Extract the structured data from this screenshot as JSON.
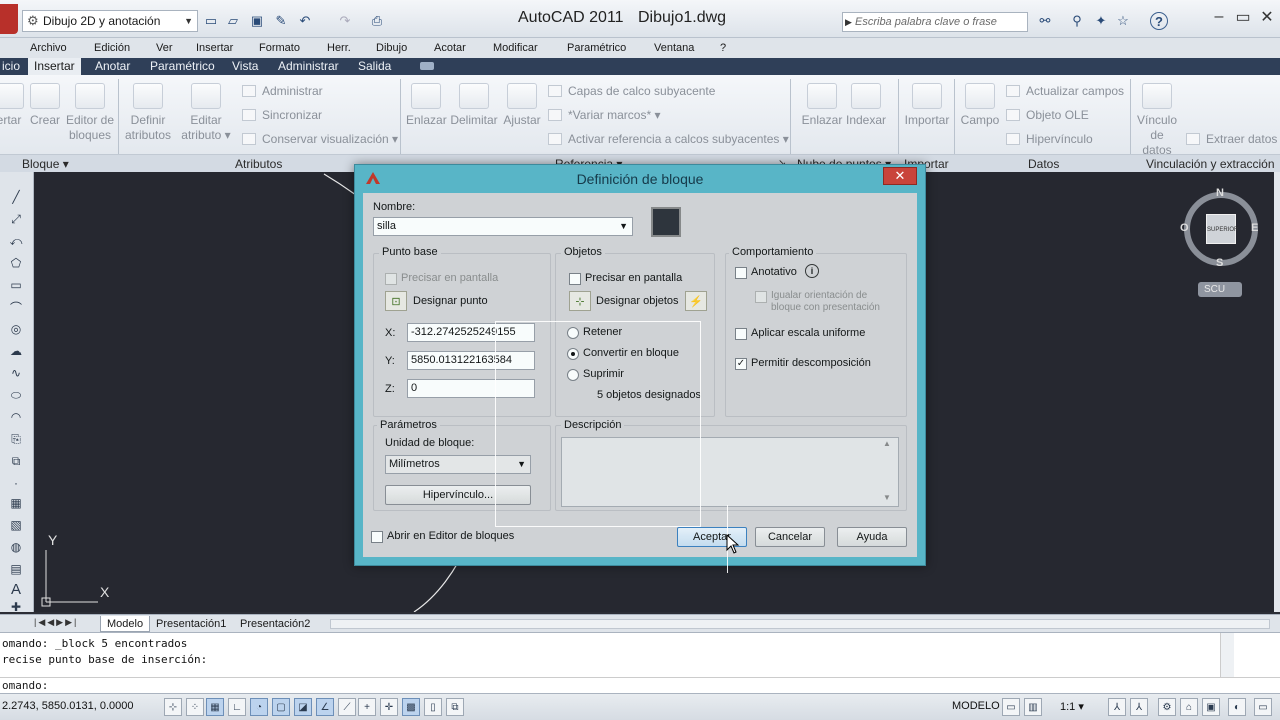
{
  "titlebar": {
    "workspace": "Dibujo 2D y anotación",
    "app_title": "AutoCAD 2011",
    "file_title": "Dibujo1.dwg",
    "search_placeholder": "Escriba palabra clave o frase",
    "help_icon": "?"
  },
  "menubar": [
    "Archivo",
    "Edición",
    "Ver",
    "Insertar",
    "Formato",
    "Herr.",
    "Dibujo",
    "Acotar",
    "Modificar",
    "Paramétrico",
    "Ventana",
    "?"
  ],
  "ribbon_tabs": [
    "icio",
    "Insertar",
    "Anotar",
    "Paramétrico",
    "Vista",
    "Administrar",
    "Salida"
  ],
  "ribbon_active_tab": "Insertar",
  "ribbon": {
    "block": {
      "label": "Bloque ▾",
      "buttons": [
        "ertar",
        "Crear",
        "Editor de\nbloques"
      ]
    },
    "attributes": {
      "label": "Atributos",
      "buttons": [
        "Definir\natributos",
        "Editar\natributo ▾"
      ],
      "small": [
        "Administrar",
        "Sincronizar",
        "Conservar visualización ▾"
      ]
    },
    "reference": {
      "label": "Referencia ▾",
      "buttons": [
        "Enlazar",
        "Delimitar",
        "Ajustar"
      ],
      "small": [
        "Capas de calco subyacente",
        "*Variar marcos* ▾",
        "Activar referencia a calcos subyacentes ▾"
      ]
    },
    "pointcloud": {
      "label": "Nube de puntos ▾",
      "buttons": [
        "Enlazar",
        "Indexar"
      ]
    },
    "import": {
      "label": "Importar",
      "buttons": [
        "Importar"
      ]
    },
    "data": {
      "label": "Datos",
      "buttons": [
        "Campo"
      ],
      "small": [
        "Actualizar campos",
        "Objeto OLE",
        "Hipervínculo"
      ]
    },
    "linking": {
      "label": "Vinculación y extracción",
      "buttons": [
        "Vínculo\nde datos"
      ],
      "small": [
        "Extraer  datos"
      ]
    }
  },
  "viewcube": {
    "north": "N",
    "south": "S",
    "east": "E",
    "west": "O",
    "face": "SUPERIOR",
    "ucs": "SCU"
  },
  "ucs_axes": {
    "x": "X",
    "y": "Y"
  },
  "layout_tabs": [
    "Modelo",
    "Presentación1",
    "Presentación2"
  ],
  "command_history": [
    "omando: _block 5 encontrados",
    "recise punto base de inserción:"
  ],
  "command_prompt": "omando:",
  "statusbar": {
    "coords": "2.2743, 5850.0131, 0.0000",
    "model": "MODELO",
    "scale": "1:1 ▾"
  },
  "dialog": {
    "title": "Definición de bloque",
    "close": "✕",
    "name_label": "Nombre:",
    "name_value": "silla",
    "base_point": {
      "title": "Punto base",
      "specify_on_screen": "Precisar en pantalla",
      "pick_button": "Designar punto",
      "x_label": "X:",
      "x_value": "-312.2742525249155",
      "y_label": "Y:",
      "y_value": "5850.013122163584",
      "z_label": "Z:",
      "z_value": "0"
    },
    "objects": {
      "title": "Objetos",
      "specify_on_screen": "Precisar en pantalla",
      "select_button": "Designar objetos",
      "retain": "Retener",
      "convert": "Convertir en bloque",
      "delete": "Suprimir",
      "count": "5 objetos designados"
    },
    "behavior": {
      "title": "Comportamiento",
      "annotative": "Anotativo",
      "match_orientation": "Igualar orientación de\nbloque con presentación",
      "uniform_scale": "Aplicar escala uniforme",
      "allow_explode": "Permitir descomposición"
    },
    "settings": {
      "title": "Parámetros",
      "unit_label": "Unidad de bloque:",
      "unit_value": "Milímetros",
      "hyperlink_button": "Hipervínculo..."
    },
    "description": {
      "title": "Descripción",
      "value": ""
    },
    "open_editor": "Abrir en Editor de bloques",
    "ok": "Aceptar",
    "cancel": "Cancelar",
    "help": "Ayuda"
  }
}
